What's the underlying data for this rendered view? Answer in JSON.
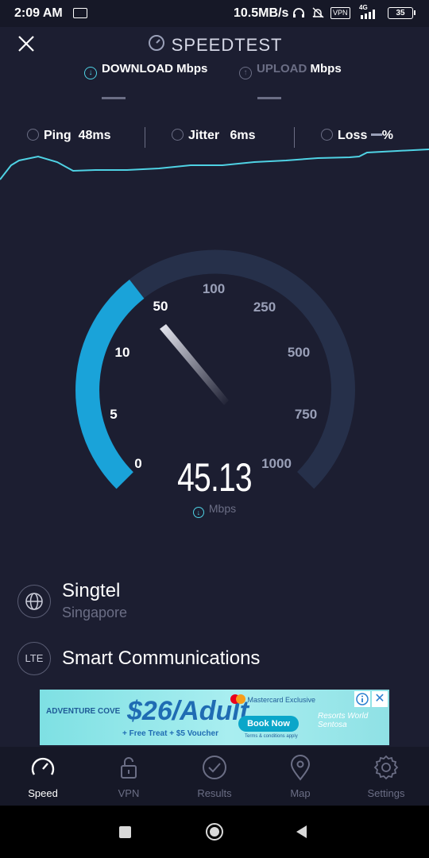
{
  "status_bar": {
    "time": "2:09 AM",
    "net_speed": "10.5MB/s",
    "vpn": "VPN",
    "signal": "4G",
    "battery": "35"
  },
  "header": {
    "title": "SPEEDTEST",
    "download_label": "DOWNLOAD",
    "upload_label": "UPLOAD",
    "unit": "Mbps"
  },
  "stats": {
    "ping_label": "Ping",
    "ping_value": "48ms",
    "jitter_label": "Jitter",
    "jitter_value": "6ms",
    "loss_label": "Loss",
    "loss_value": "%"
  },
  "gauge": {
    "ticks": [
      "0",
      "5",
      "10",
      "50",
      "100",
      "250",
      "500",
      "750",
      "1000"
    ],
    "reading": "45.13",
    "reading_unit": "Mbps",
    "fill_value": 45.13,
    "colors": {
      "fill": "#1aa3d9",
      "track": "#26304a"
    }
  },
  "isp": {
    "provider_name": "Singtel",
    "provider_location": "Singapore",
    "server_badge": "LTE",
    "server_name": "Smart Communications"
  },
  "ad": {
    "brand": "ADVENTURE COVE",
    "price": "$26/Adult",
    "sub": "+ Free Treat + $5 Voucher",
    "partner": "Mastercard Exclusive",
    "cta": "Book Now",
    "brand2": "Resorts World Sentosa",
    "terms": "Terms & conditions apply"
  },
  "nav": {
    "tabs": [
      {
        "label": "Speed",
        "icon": "speed-icon",
        "active": true
      },
      {
        "label": "VPN",
        "icon": "lock-icon",
        "active": false
      },
      {
        "label": "Results",
        "icon": "check-icon",
        "active": false
      },
      {
        "label": "Map",
        "icon": "map-pin-icon",
        "active": false
      },
      {
        "label": "Settings",
        "icon": "gear-icon",
        "active": false
      }
    ]
  },
  "colors": {
    "background": "#1c1e31",
    "accent": "#4fd2e4",
    "muted": "#6b6e85"
  }
}
